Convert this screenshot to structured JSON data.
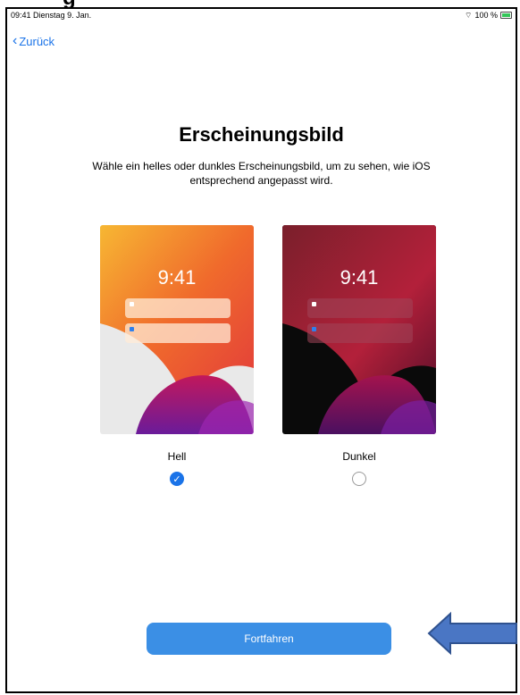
{
  "header_cropped_text": "g",
  "status_bar": {
    "time": "09:41",
    "date": "Dienstag 9. Jan.",
    "battery": "100 %",
    "wifi_icon": "wifi-icon",
    "battery_icon": "battery-icon"
  },
  "nav": {
    "back_label": "Zurück",
    "back_icon": "chevron-left-icon"
  },
  "title": "Erscheinungsbild",
  "subtitle": "Wähle ein helles oder dunkles Erscheinungsbild, um zu sehen, wie iOS entsprechend angepasst wird.",
  "options": [
    {
      "label": "Hell",
      "clock": "9:41",
      "selected": true
    },
    {
      "label": "Dunkel",
      "clock": "9:41",
      "selected": false
    }
  ],
  "continue_label": "Fortfahren",
  "colors": {
    "accent": "#1a73e8",
    "button": "#3b8fe5",
    "arrow_fill": "#4a76c4",
    "arrow_stroke": "#2f528f"
  }
}
